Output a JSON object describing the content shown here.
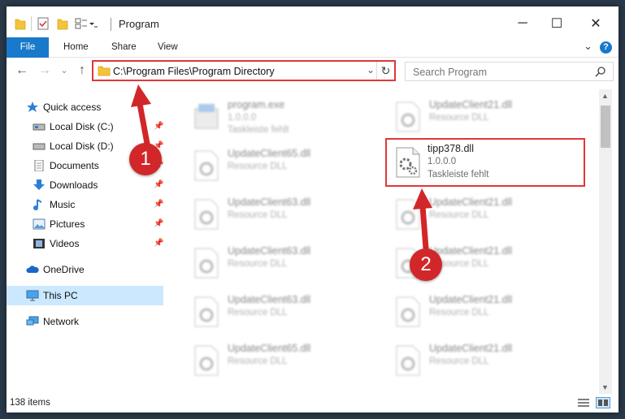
{
  "window": {
    "title": "Program",
    "controls": {
      "minimize": "─",
      "maximize": "☐",
      "close": "✕"
    }
  },
  "ribbon": {
    "tabs": [
      "File",
      "Home",
      "Share",
      "View"
    ],
    "help": "?",
    "expand": "⌄"
  },
  "address": {
    "path": "C:\\Program Files\\Program Directory",
    "refresh": "↻",
    "dropdown": "⌄"
  },
  "search": {
    "placeholder": "Search Program"
  },
  "nav": {
    "back": "←",
    "forward": "→",
    "recent": "⌄",
    "up": "↑",
    "pin": "📌",
    "items": [
      {
        "label": "Quick access",
        "icon": "star-icon",
        "pinned": false
      },
      {
        "label": "Local Disk (C:)",
        "icon": "disk-icon",
        "pinned": true
      },
      {
        "label": "Local Disk (D:)",
        "icon": "disk-icon",
        "pinned": true
      },
      {
        "label": "Documents",
        "icon": "documents-icon",
        "pinned": true
      },
      {
        "label": "Downloads",
        "icon": "download-icon",
        "pinned": true
      },
      {
        "label": "Music",
        "icon": "music-icon",
        "pinned": true
      },
      {
        "label": "Pictures",
        "icon": "pictures-icon",
        "pinned": true
      },
      {
        "label": "Videos",
        "icon": "videos-icon",
        "pinned": true
      },
      {
        "label": "OneDrive",
        "icon": "cloud-icon",
        "pinned": false
      },
      {
        "label": "This PC",
        "icon": "pc-icon",
        "pinned": false,
        "selected": true
      },
      {
        "label": "Network",
        "icon": "network-icon",
        "pinned": false
      }
    ]
  },
  "files": {
    "left": [
      {
        "name": "program.exe",
        "line2": "1.0.0.0",
        "line3": "Taskleiste fehlt",
        "icon": "exe-icon"
      },
      {
        "name": "UpdateClient65.dll",
        "line2": "Resource DLL",
        "line3": "",
        "icon": "dll-icon"
      },
      {
        "name": "UpdateClient63.dll",
        "line2": "Resource DLL",
        "line3": "",
        "icon": "dll-icon"
      },
      {
        "name": "UpdateClient63.dll",
        "line2": "Resource DLL",
        "line3": "",
        "icon": "dll-icon"
      },
      {
        "name": "UpdateClient63.dll",
        "line2": "Resource DLL",
        "line3": "",
        "icon": "dll-icon"
      },
      {
        "name": "UpdateClient65.dll",
        "line2": "Resource DLL",
        "line3": "",
        "icon": "dll-icon"
      }
    ],
    "right": [
      {
        "name": "UpdateClient21.dll",
        "line2": "Resource DLL",
        "line3": "",
        "icon": "dll-icon"
      },
      {
        "name": "tipp378.dll",
        "line2": "1.0.0.0",
        "line3": "Taskleiste fehlt",
        "icon": "dll-icon",
        "highlight": true
      },
      {
        "name": "UpdateClient21.dll",
        "line2": "Resource DLL",
        "line3": "",
        "icon": "dll-icon"
      },
      {
        "name": "UpdateClient21.dll",
        "line2": "Resource DLL",
        "line3": "",
        "icon": "dll-icon"
      },
      {
        "name": "UpdateClient21.dll",
        "line2": "Resource DLL",
        "line3": "",
        "icon": "dll-icon"
      },
      {
        "name": "UpdateClient21.dll",
        "line2": "Resource DLL",
        "line3": "",
        "icon": "dll-icon"
      }
    ]
  },
  "status": {
    "items": "138 items"
  },
  "annotations": {
    "step1": "1",
    "step2": "2"
  },
  "colors": {
    "accent": "#1979ca",
    "highlight": "#e0373a",
    "selected": "#cce8ff",
    "badge": "#d2272a"
  }
}
